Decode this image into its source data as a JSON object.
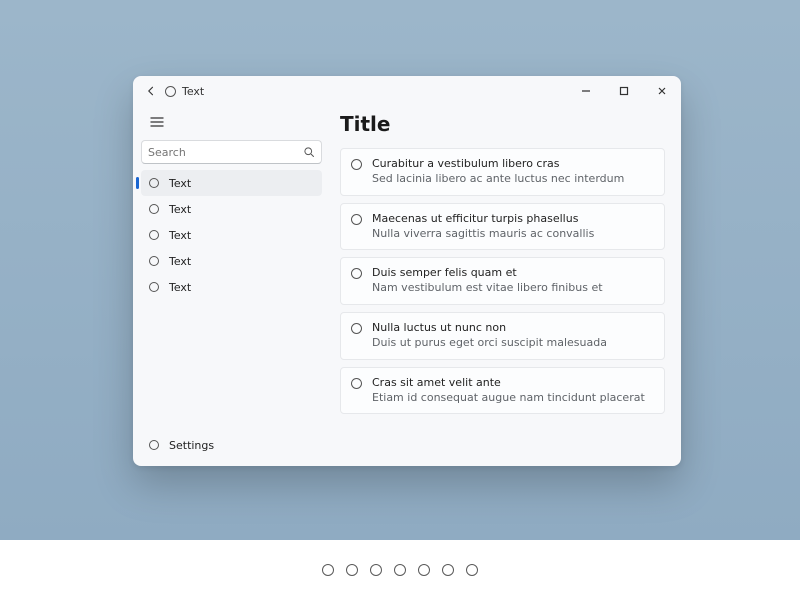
{
  "titlebar": {
    "title": "Text"
  },
  "sidebar": {
    "search_placeholder": "Search",
    "items": [
      {
        "label": "Text",
        "selected": true
      },
      {
        "label": "Text",
        "selected": false
      },
      {
        "label": "Text",
        "selected": false
      },
      {
        "label": "Text",
        "selected": false
      },
      {
        "label": "Text",
        "selected": false
      }
    ],
    "settings_label": "Settings"
  },
  "content": {
    "heading": "Title",
    "cards": [
      {
        "line1": "Curabitur a vestibulum libero cras",
        "line2": "Sed lacinia libero ac ante luctus nec interdum"
      },
      {
        "line1": "Maecenas ut efficitur turpis phasellus",
        "line2": "Nulla viverra sagittis mauris ac convallis"
      },
      {
        "line1": "Duis semper felis quam et",
        "line2": "Nam vestibulum est vitae libero finibus et"
      },
      {
        "line1": "Nulla luctus ut nunc non",
        "line2": "Duis ut purus eget orci suscipit malesuada"
      },
      {
        "line1": "Cras sit amet velit ante",
        "line2": "Etiam id consequat augue nam tincidunt placerat"
      }
    ]
  },
  "footer": {
    "dot_count": 7
  }
}
